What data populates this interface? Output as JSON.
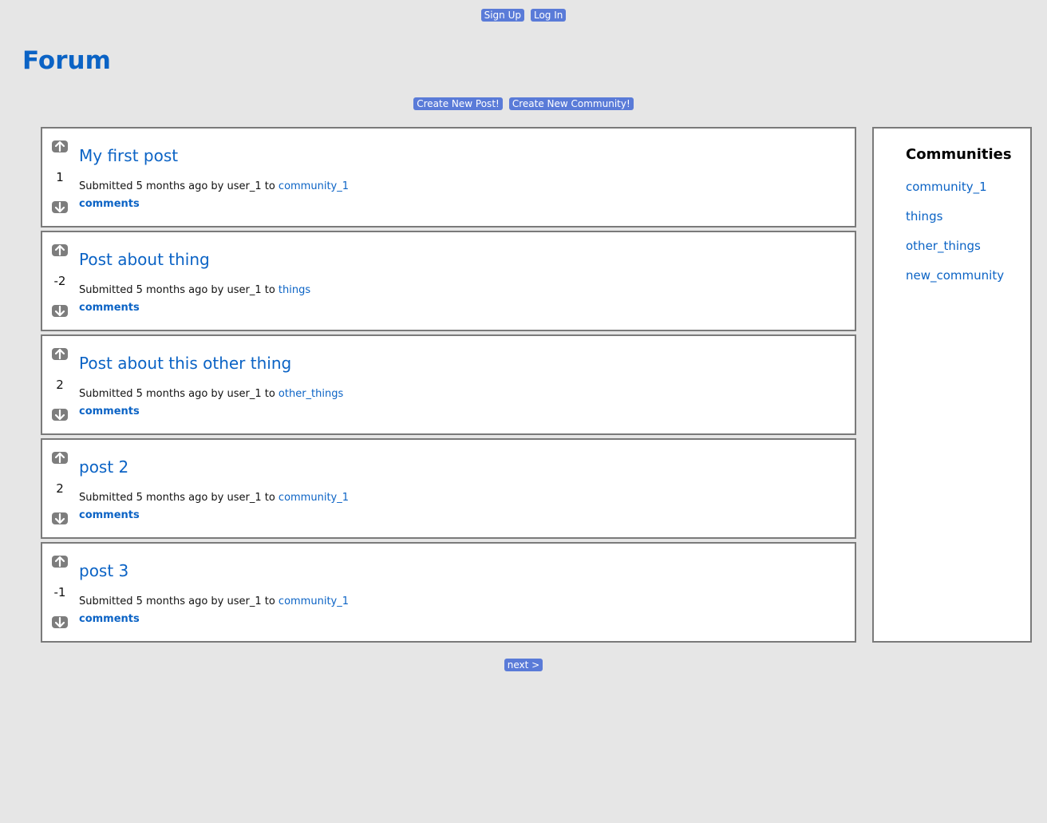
{
  "header": {
    "signup_label": "Sign Up",
    "login_label": "Log In",
    "title": "Forum"
  },
  "actions": {
    "create_post_label": "Create New Post!",
    "create_community_label": "Create New Community!"
  },
  "posts": [
    {
      "score": "1",
      "title": "My first post",
      "meta_prefix": "Submitted 5 months ago by user_1 to ",
      "community": "community_1",
      "comments_label": "comments"
    },
    {
      "score": "-2",
      "title": "Post about thing",
      "meta_prefix": "Submitted 5 months ago by user_1 to ",
      "community": "things",
      "comments_label": "comments"
    },
    {
      "score": "2",
      "title": "Post about this other thing",
      "meta_prefix": "Submitted 5 months ago by user_1 to ",
      "community": "other_things",
      "comments_label": "comments"
    },
    {
      "score": "2",
      "title": "post 2",
      "meta_prefix": "Submitted 5 months ago by user_1 to ",
      "community": "community_1",
      "comments_label": "comments"
    },
    {
      "score": "-1",
      "title": "post 3",
      "meta_prefix": "Submitted 5 months ago by user_1 to ",
      "community": "community_1",
      "comments_label": "comments"
    }
  ],
  "sidebar": {
    "heading": "Communities",
    "communities": [
      "community_1",
      "things",
      "other_things",
      "new_community"
    ]
  },
  "pagination": {
    "next_label": "next >"
  },
  "colors": {
    "background": "#e6e6e6",
    "link": "#0b63c5",
    "button": "#5a7bd8",
    "vote_button": "#7d7d7d",
    "card_border": "#7a7a7a"
  },
  "icons": {
    "upvote": "arrow-up-icon",
    "downvote": "arrow-down-icon"
  }
}
